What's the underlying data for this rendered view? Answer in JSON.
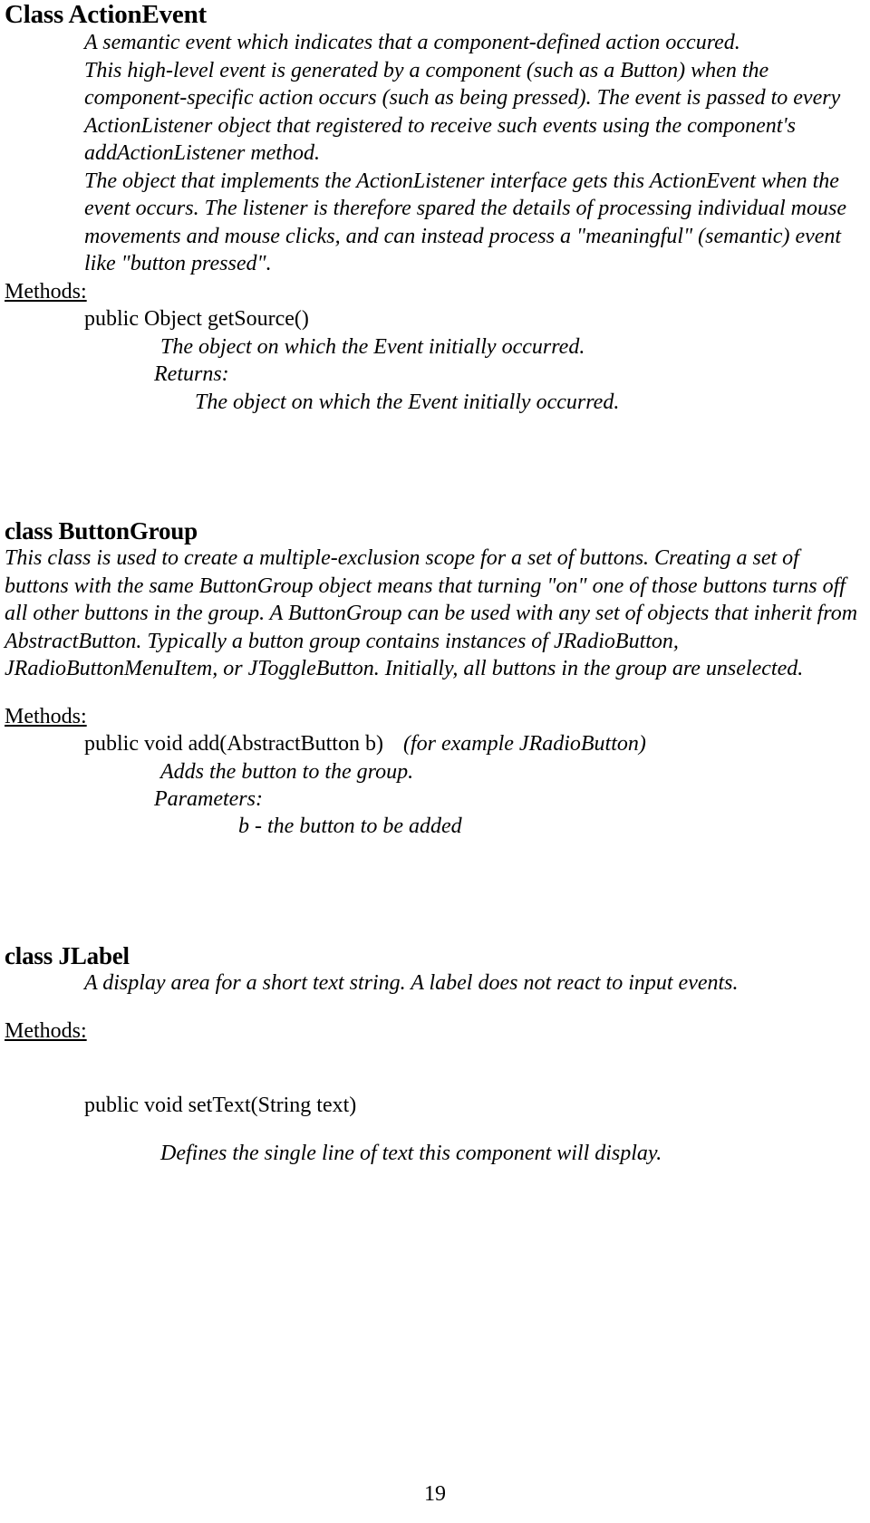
{
  "page": {
    "number": "19"
  },
  "sections": [
    {
      "id": "action-event",
      "heading": "Class ActionEvent",
      "description_lines": [
        "A semantic event which indicates that a component-defined action occured.",
        "This high-level event is generated by a component (such as a Button) when the component-specific action occurs (such as being pressed). The event is passed to every ActionListener object that registered to receive such events using the component's addActionListener method.",
        "The object that implements the ActionListener interface gets this ActionEvent when the event occurs. The listener is therefore spared the details of processing individual mouse movements and mouse clicks, and can instead process a \"meaningful\" (semantic) event like \"button pressed\"."
      ],
      "methods_label": "Methods:",
      "methods": [
        {
          "signature": "public Object getSource()",
          "note": "",
          "description": "The object on which the Event initially occurred.",
          "sub_label": "Returns:",
          "sub_description": "The object on which the Event initially occurred."
        }
      ]
    },
    {
      "id": "button-group",
      "heading": "class ButtonGroup",
      "description_lines": [
        "This class is used to create a multiple-exclusion scope for a set of buttons. Creating a set of buttons with the same ButtonGroup object means that turning \"on\" one of those buttons turns off all other buttons in the group. A ButtonGroup can be used with any set of objects that inherit from AbstractButton. Typically a button group contains instances of JRadioButton, JRadioButtonMenuItem, or JToggleButton. Initially, all buttons in the group are unselected."
      ],
      "methods_label": "Methods:",
      "methods": [
        {
          "signature": "public void add(AbstractButton b)",
          "note": "(for example JRadioButton)",
          "description": "Adds the button to the group.",
          "sub_label": "Parameters:",
          "sub_description": "b - the button to be added"
        }
      ]
    },
    {
      "id": "jlabel",
      "heading": "class JLabel",
      "description_lines": [
        "A display area for a short text string. A label does not react to input events."
      ],
      "methods_label": "Methods:",
      "methods": [
        {
          "signature": "public void setText(String text)",
          "note": "",
          "description": "Defines the single line of text this component will display.",
          "sub_label": "",
          "sub_description": ""
        }
      ]
    }
  ]
}
